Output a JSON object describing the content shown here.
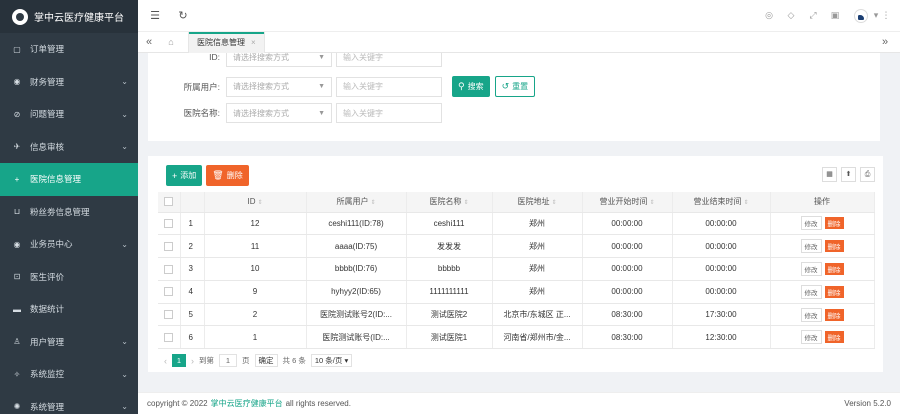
{
  "app": {
    "title": "掌中云医疗健康平台"
  },
  "sidebar": {
    "items": [
      {
        "icon": "▢",
        "label": "订单管理",
        "arrow": ""
      },
      {
        "icon": "◉",
        "label": "财务管理",
        "arrow": "⌄"
      },
      {
        "icon": "⊘",
        "label": "问题管理",
        "arrow": "⌄"
      },
      {
        "icon": "✈",
        "label": "信息审核",
        "arrow": "⌄"
      },
      {
        "icon": "+",
        "label": "医院信息管理",
        "arrow": ""
      },
      {
        "icon": "⊔",
        "label": "粉丝劵信息管理",
        "arrow": ""
      },
      {
        "icon": "◉",
        "label": "业务员中心",
        "arrow": "⌄"
      },
      {
        "icon": "⊡",
        "label": "医生评价",
        "arrow": ""
      },
      {
        "icon": "▬",
        "label": "数据统计",
        "arrow": ""
      },
      {
        "icon": "♙",
        "label": "用户管理",
        "arrow": "⌄"
      },
      {
        "icon": "✧",
        "label": "系统监控",
        "arrow": "⌄"
      },
      {
        "icon": "✺",
        "label": "系统管理",
        "arrow": "⌄"
      }
    ]
  },
  "header": {
    "menu_icon": "☰",
    "refresh_icon": "↻"
  },
  "tabbar": {
    "tab_label": "医院信息管理"
  },
  "filters": {
    "row0_label": "ID:",
    "row1_label": "所属用户:",
    "row2_label": "医院名称:",
    "select_placeholder": "请选择搜索方式",
    "input_placeholder": "输入关键字",
    "search_label": "搜索",
    "reset_label": "重置"
  },
  "toolbar": {
    "add_label": "添加",
    "delete_label": "删除"
  },
  "table": {
    "columns": [
      "ID",
      "所属用户",
      "医院名称",
      "医院地址",
      "营业开始时间",
      "营业结束时间",
      "操作"
    ],
    "rows": [
      {
        "no": "1",
        "id": "12",
        "user": "ceshi111(ID:78)",
        "hospital": "ceshi111",
        "address": "郑州",
        "start": "00:00:00",
        "end": "00:00:00"
      },
      {
        "no": "2",
        "id": "11",
        "user": "aaaa(ID:75)",
        "hospital": "发发发",
        "address": "郑州",
        "start": "00:00:00",
        "end": "00:00:00"
      },
      {
        "no": "3",
        "id": "10",
        "user": "bbbb(ID:76)",
        "hospital": "bbbbb",
        "address": "郑州",
        "start": "00:00:00",
        "end": "00:00:00"
      },
      {
        "no": "4",
        "id": "9",
        "user": "hyhyy2(ID:65)",
        "hospital": "1111111111",
        "address": "郑州",
        "start": "00:00:00",
        "end": "00:00:00"
      },
      {
        "no": "5",
        "id": "2",
        "user": "医院测试账号2(ID:...",
        "hospital": "测试医院2",
        "address": "北京市/东城区 正...",
        "start": "08:30:00",
        "end": "17:30:00"
      },
      {
        "no": "6",
        "id": "1",
        "user": "医院测试账号(ID:...",
        "hospital": "测试医院1",
        "address": "河南省/郑州市/金...",
        "start": "08:30:00",
        "end": "12:30:00"
      }
    ],
    "edit_label": "修改",
    "delete_label": "删除"
  },
  "pager": {
    "current_page": "1",
    "goto_label": "到第",
    "goto_value": "1",
    "page_unit": "页",
    "confirm_label": "确定",
    "total_label": "共 6 条",
    "page_size": "10 条/页"
  },
  "footer": {
    "prefix": "copyright © 2022",
    "brand": "掌中云医疗健康平台",
    "suffix": "all rights reserved.",
    "version": "Version 5.2.0"
  }
}
